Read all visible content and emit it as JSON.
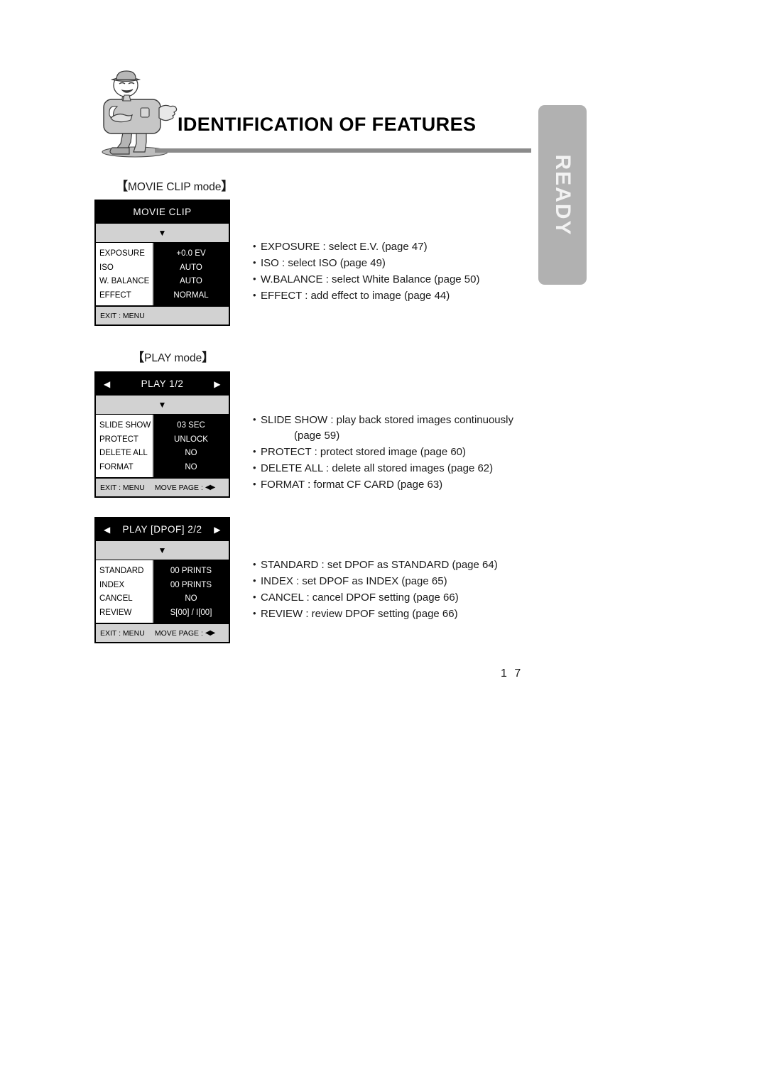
{
  "document": {
    "title": "IDENTIFICATION OF FEATURES",
    "page_number": "1 7",
    "side_tab_label": "READY"
  },
  "sections": [
    {
      "caption_open": "【",
      "caption_text": "MOVIE CLIP mode",
      "caption_close": "】",
      "panel": {
        "header_title": "MOVIE  CLIP",
        "has_page_arrows": false,
        "arrow_left": "◀",
        "arrow_right": "▶",
        "down_triangle": "▼",
        "rows": [
          {
            "label": "EXPOSURE",
            "value": "+0.0  EV"
          },
          {
            "label": "ISO",
            "value": "AUTO"
          },
          {
            "label": "W. BALANCE",
            "value": "AUTO"
          },
          {
            "label": "EFFECT",
            "value": "NORMAL"
          }
        ],
        "footer_exit": "EXIT : MENU",
        "footer_move": "",
        "footer_move_arrows": ""
      },
      "descriptions": [
        {
          "text": "EXPOSURE : select E.V. (page 47)",
          "continuation": null
        },
        {
          "text": "ISO : select ISO (page 49)",
          "continuation": null
        },
        {
          "text": "W.BALANCE : select White Balance (page 50)",
          "continuation": null
        },
        {
          "text": "EFFECT : add effect to image (page 44)",
          "continuation": null
        }
      ]
    },
    {
      "caption_open": "【",
      "caption_text": "PLAY mode",
      "caption_close": "】",
      "panel": {
        "header_title": "PLAY  1/2",
        "has_page_arrows": true,
        "arrow_left": "◀",
        "arrow_right": "▶",
        "down_triangle": "▼",
        "rows": [
          {
            "label": "SLIDE SHOW",
            "value": "03 SEC"
          },
          {
            "label": "PROTECT",
            "value": "UNLOCK"
          },
          {
            "label": "DELETE ALL",
            "value": "NO"
          },
          {
            "label": "FORMAT",
            "value": "NO"
          }
        ],
        "footer_exit": "EXIT : MENU",
        "footer_move": "MOVE PAGE :",
        "footer_move_arrows": "◀▶"
      },
      "descriptions": [
        {
          "text": "SLIDE SHOW : play back stored images continuously",
          "continuation": "(page 59)"
        },
        {
          "text": "PROTECT : protect stored image (page 60)",
          "continuation": null
        },
        {
          "text": "DELETE ALL : delete all stored images (page 62)",
          "continuation": null
        },
        {
          "text": "FORMAT : format CF CARD (page 63)",
          "continuation": null
        }
      ]
    },
    {
      "caption_open": "",
      "caption_text": "",
      "caption_close": "",
      "panel": {
        "header_title": "PLAY [DPOF]  2/2",
        "has_page_arrows": true,
        "arrow_left": "◀",
        "arrow_right": "▶",
        "down_triangle": "▼",
        "rows": [
          {
            "label": "STANDARD",
            "value": "00 PRINTS"
          },
          {
            "label": "INDEX",
            "value": "00 PRINTS"
          },
          {
            "label": "CANCEL",
            "value": "NO"
          },
          {
            "label": "REVIEW",
            "value": "S[00] / I[00]"
          }
        ],
        "footer_exit": "EXIT : MENU",
        "footer_move": "MOVE PAGE :",
        "footer_move_arrows": "◀▶"
      },
      "descriptions": [
        {
          "text": "STANDARD : set DPOF as STANDARD (page 64)",
          "continuation": null
        },
        {
          "text": "INDEX : set DPOF as INDEX (page 65)",
          "continuation": null
        },
        {
          "text": "CANCEL : cancel DPOF setting (page 66)",
          "continuation": null
        },
        {
          "text": "REVIEW : review DPOF setting (page 66)",
          "continuation": null
        }
      ]
    }
  ]
}
